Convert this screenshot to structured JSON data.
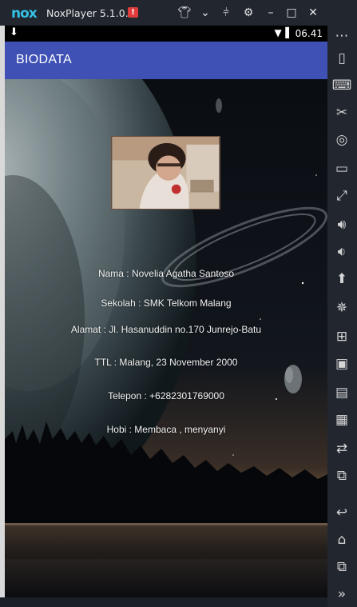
{
  "window": {
    "app_name": "NoxPlayer 5.1.0.0",
    "logo_text": "nox",
    "alert_badge": "!"
  },
  "status_bar": {
    "time": "06.41"
  },
  "app_bar": {
    "title": "BIODATA"
  },
  "biodata": {
    "nama": "Nama : Novelia Agatha Santoso",
    "sekolah": "Sekolah : SMK Telkom Malang",
    "alamat": "Alamat : Jl. Hasanuddin no.170 Junrejo-Batu",
    "ttl": "TTL : Malang, 23 November 2000",
    "telepon": "Telepon : +6282301769000",
    "hobi": "Hobi : Membaca , menyanyi"
  },
  "sidebar_icons": [
    "more-icon",
    "shake-icon",
    "keyboard-icon",
    "scissors-icon",
    "location-icon",
    "screen-icon",
    "fullscreen-icon",
    "volume-up-icon",
    "volume-down-icon",
    "apk-icon",
    "loading-icon",
    "add-icon",
    "bus-icon",
    "toolbox-icon",
    "gamepad-icon",
    "sync-icon",
    "multi-window-icon",
    "back-icon",
    "home-icon",
    "recents-icon",
    "expand-icon"
  ],
  "colors": {
    "appbar": "#3f51b5",
    "frame": "#21262f",
    "nox_logo": "#35c2e6"
  }
}
